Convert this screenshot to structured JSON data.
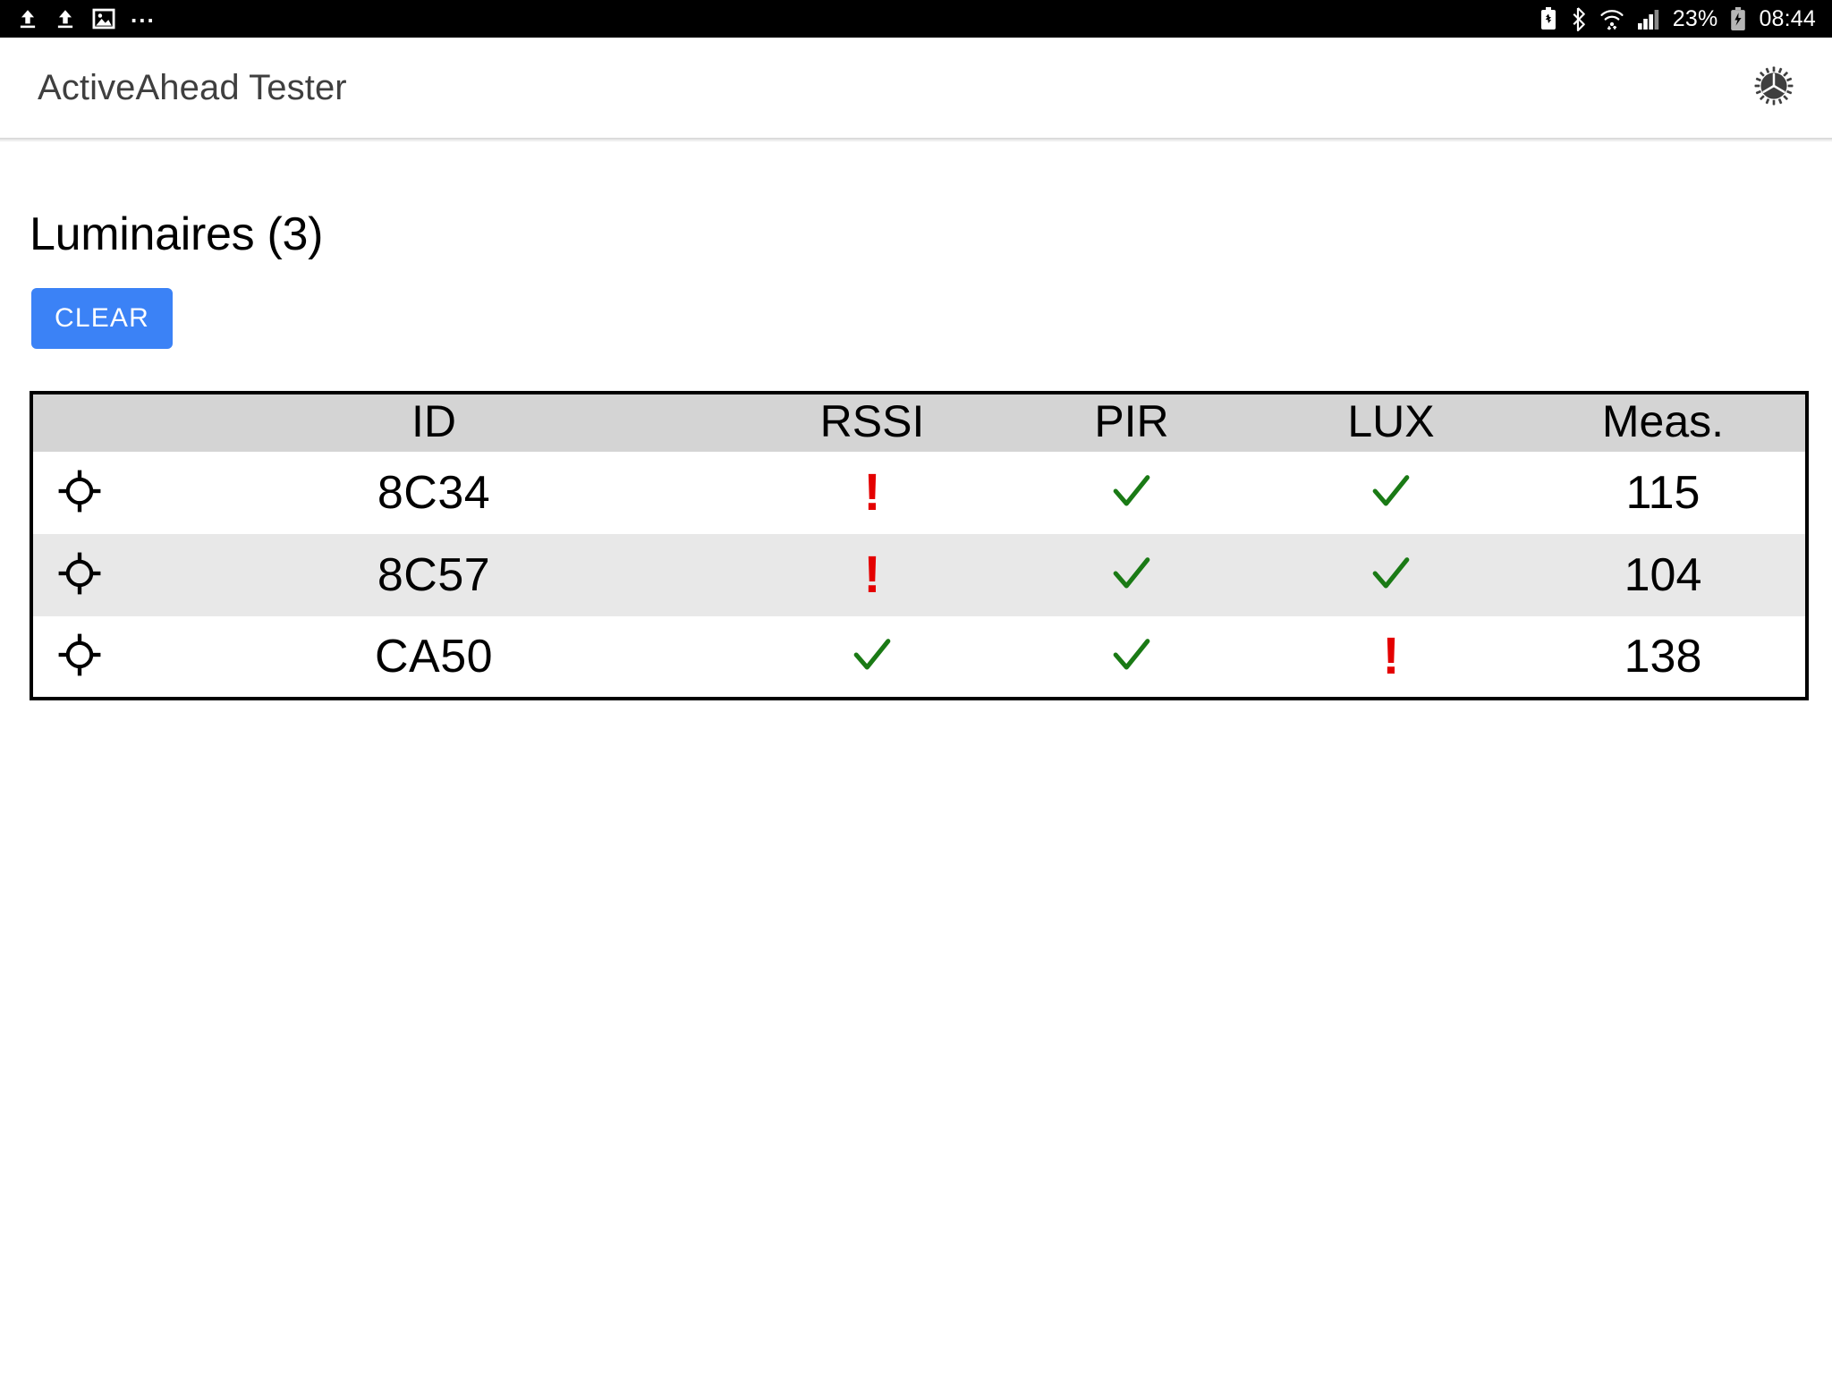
{
  "status_bar": {
    "left_icons": [
      "upload-icon",
      "upload-icon",
      "image-icon"
    ],
    "overflow": "...",
    "battery_percent": "23%",
    "time": "08:44",
    "right_icons": [
      "battery-saver-icon",
      "bluetooth-icon",
      "wifi-icon",
      "cellular-signal-icon",
      "battery-charging-icon"
    ]
  },
  "app_bar": {
    "title": "ActiveAhead Tester",
    "settings_icon": "gear-icon"
  },
  "page": {
    "title": "Luminaires (3)",
    "clear_label": "CLEAR"
  },
  "table": {
    "columns": [
      "",
      "ID",
      "RSSI",
      "PIR",
      "LUX",
      "Meas."
    ],
    "rows": [
      {
        "icon": "crosshair-location-icon",
        "id": "8C34",
        "rssi": "!",
        "pir": "✓",
        "lux": "✓",
        "meas": "115"
      },
      {
        "icon": "crosshair-location-icon",
        "id": "8C57",
        "rssi": "!",
        "pir": "✓",
        "lux": "✓",
        "meas": "104"
      },
      {
        "icon": "crosshair-location-icon",
        "id": "CA50",
        "rssi": "✓",
        "pir": "✓",
        "lux": "!",
        "meas": "138"
      }
    ]
  },
  "colors": {
    "accent": "#3b82f6",
    "ok": "#1a7a15",
    "alert": "#e40000",
    "header_bg": "#d4d4d4",
    "alt_row_bg": "#e8e8e8",
    "title_text": "#3f3f3f"
  }
}
